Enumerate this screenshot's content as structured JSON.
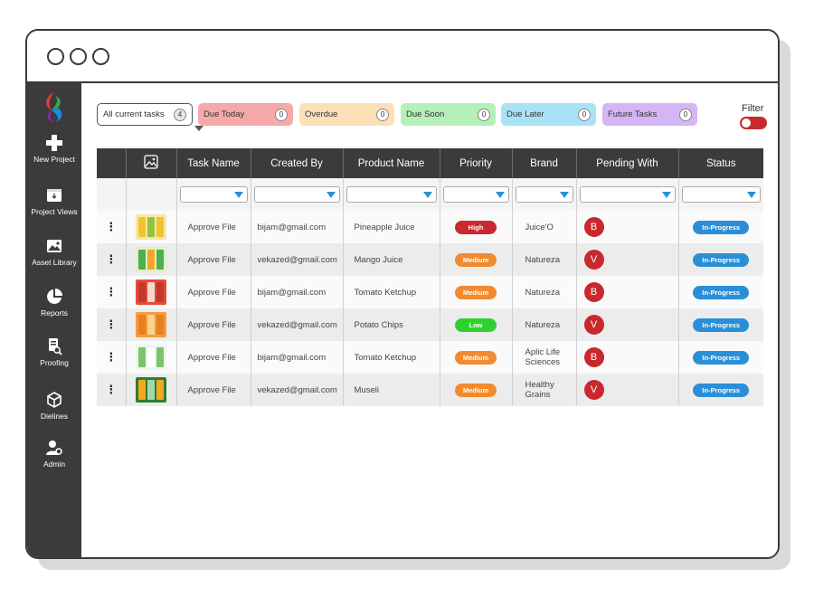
{
  "sidebar": {
    "items": [
      {
        "label": "New Project",
        "icon": "plus-icon"
      },
      {
        "label": "Project Views",
        "icon": "project-views-icon"
      },
      {
        "label": "Asset Library",
        "icon": "image-icon"
      },
      {
        "label": "Reports",
        "icon": "pie-chart-icon"
      },
      {
        "label": "Proofing",
        "icon": "proofing-icon"
      },
      {
        "label": "Dielines",
        "icon": "box-icon"
      },
      {
        "label": "Admin",
        "icon": "admin-user-icon"
      }
    ]
  },
  "chips": [
    {
      "label": "All current tasks",
      "count": "4",
      "color": "#ffffff"
    },
    {
      "label": "Due Today",
      "count": "0",
      "color": "#f7a9aa"
    },
    {
      "label": "Overdue",
      "count": "0",
      "color": "#fde0b6"
    },
    {
      "label": "Due Soon",
      "count": "0",
      "color": "#b5f0b8"
    },
    {
      "label": "Due Later",
      "count": "0",
      "color": "#a9e2f7"
    },
    {
      "label": "Future Tasks",
      "count": "0",
      "color": "#d5b6f5"
    }
  ],
  "filter": {
    "label": "Filter"
  },
  "table": {
    "headers": [
      "",
      "image-icon",
      "Task Name",
      "Created By",
      "Product Name",
      "Priority",
      "Brand",
      "Pending With",
      "Status"
    ],
    "rows": [
      {
        "task": "Approve File",
        "created_by": "bijam@gmail.com",
        "product": "Pineapple Juice",
        "priority": "High",
        "brand": "Juice'O",
        "pending": "B",
        "status": "In-Progress"
      },
      {
        "task": "Approve File",
        "created_by": "vekazed@gmail.com",
        "product": "Mango Juice",
        "priority": "Medium",
        "brand": "Natureza",
        "pending": "V",
        "status": "In-Progress"
      },
      {
        "task": "Approve File",
        "created_by": "bijam@gmail.com",
        "product": "Tomato Ketchup",
        "priority": "Medium",
        "brand": "Natureza",
        "pending": "B",
        "status": "In-Progress"
      },
      {
        "task": "Approve File",
        "created_by": "vekazed@gmail.com",
        "product": "Potato Chips",
        "priority": "Low",
        "brand": "Natureza",
        "pending": "V",
        "status": "In-Progress"
      },
      {
        "task": "Approve File",
        "created_by": "bijam@gmail.com",
        "product": "Tomato Ketchup",
        "priority": "Medium",
        "brand": "Aplic Life Sciences",
        "pending": "B",
        "status": "In-Progress"
      },
      {
        "task": "Approve File",
        "created_by": "vekazed@gmail.com",
        "product": "Museli",
        "priority": "Medium",
        "brand": "Healthy Grains",
        "pending": "V",
        "status": "In-Progress"
      }
    ]
  },
  "colors": {
    "priority_high": "#c8282e",
    "priority_medium": "#f28a2e",
    "priority_low": "#2fd12f",
    "status": "#2a8fd6",
    "avatar": "#c8282e",
    "sidebar": "#3b3b3b"
  }
}
